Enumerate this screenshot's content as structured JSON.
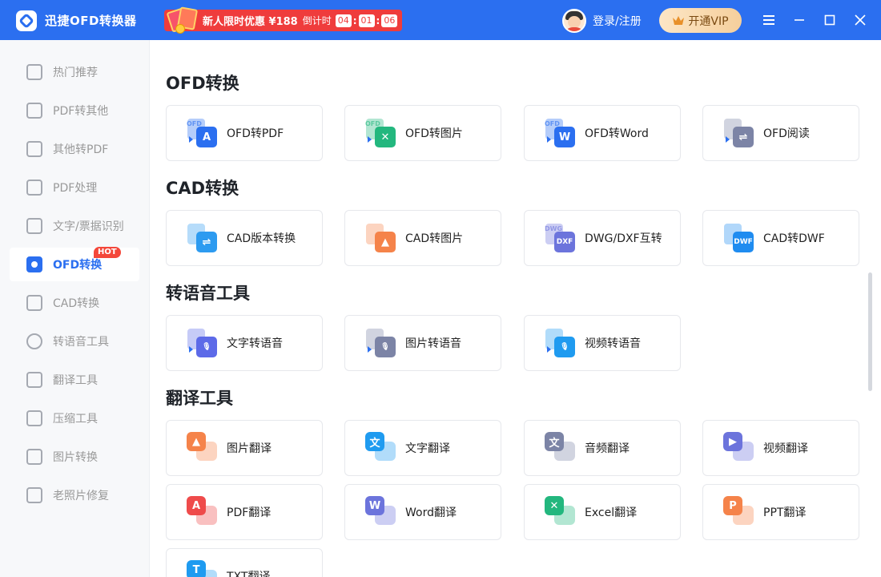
{
  "app": {
    "title": "迅捷OFD转换器"
  },
  "promo": {
    "text": "新人限时优惠 ¥188",
    "countdown_label": "倒计时",
    "hours": "04",
    "minutes": "01",
    "seconds": "06"
  },
  "header": {
    "login": "登录/注册",
    "vip": "开通VIP"
  },
  "sidebar": {
    "items": [
      {
        "label": "热门推荐"
      },
      {
        "label": "PDF转其他"
      },
      {
        "label": "其他转PDF"
      },
      {
        "label": "PDF处理"
      },
      {
        "label": "文字/票据识别"
      },
      {
        "label": "OFD转换",
        "badge": "HOT"
      },
      {
        "label": "CAD转换"
      },
      {
        "label": "转语音工具"
      },
      {
        "label": "翻译工具"
      },
      {
        "label": "压缩工具"
      },
      {
        "label": "图片转换"
      },
      {
        "label": "老照片修复"
      }
    ]
  },
  "sections": [
    {
      "title": "OFD转换",
      "cards": [
        {
          "label": "OFD转PDF",
          "glyph": "A",
          "color": "#2b6ff0",
          "tag": "OFD"
        },
        {
          "label": "OFD转图片",
          "glyph": "✕",
          "color": "#23b77e",
          "tag": "OFD"
        },
        {
          "label": "OFD转Word",
          "glyph": "W",
          "color": "#2b6ff0",
          "tag": "OFD"
        },
        {
          "label": "OFD阅读",
          "glyph": "⇌",
          "color": "#7c84a6",
          "tag": ""
        }
      ]
    },
    {
      "title": "CAD转换",
      "cards": [
        {
          "label": "CAD版本转换",
          "glyph": "⇌",
          "color": "#2d9bf0",
          "tag": ""
        },
        {
          "label": "CAD转图片",
          "glyph": "▲",
          "color": "#f5834a",
          "tag": ""
        },
        {
          "label": "DWG/DXF互转",
          "glyph": "DXF",
          "color": "#6c74dc",
          "tag": "DWG"
        },
        {
          "label": "CAD转DWF",
          "glyph": "DWF",
          "color": "#1f8cf0",
          "tag": ""
        }
      ]
    },
    {
      "title": "转语音工具",
      "cards": [
        {
          "label": "文字转语音",
          "glyph": "🎙",
          "color": "#5d6ae8",
          "tag": ""
        },
        {
          "label": "图片转语音",
          "glyph": "🎙",
          "color": "#7c84a6",
          "tag": ""
        },
        {
          "label": "视频转语音",
          "glyph": "🎙",
          "color": "#1f9bf0",
          "tag": ""
        }
      ]
    },
    {
      "title": "翻译工具",
      "cards": [
        {
          "label": "图片翻译",
          "glyph": "▲",
          "color": "#f5834a"
        },
        {
          "label": "文字翻译",
          "glyph": "文",
          "color": "#1f9bf0"
        },
        {
          "label": "音频翻译",
          "glyph": "文",
          "color": "#7c84a6"
        },
        {
          "label": "视频翻译",
          "glyph": "▶",
          "color": "#6c74dc"
        },
        {
          "label": "PDF翻译",
          "glyph": "A",
          "color": "#ef4b4b"
        },
        {
          "label": "Word翻译",
          "glyph": "W",
          "color": "#6c74dc"
        },
        {
          "label": "Excel翻译",
          "glyph": "✕",
          "color": "#23b77e"
        },
        {
          "label": "PPT翻译",
          "glyph": "P",
          "color": "#f5834a"
        },
        {
          "label": "TXT翻译",
          "glyph": "T",
          "color": "#1f9bf0"
        }
      ]
    }
  ],
  "colors": {
    "brand": "#2b6ff0",
    "promo": "#ef3c3c",
    "hot": "#f4473a"
  }
}
